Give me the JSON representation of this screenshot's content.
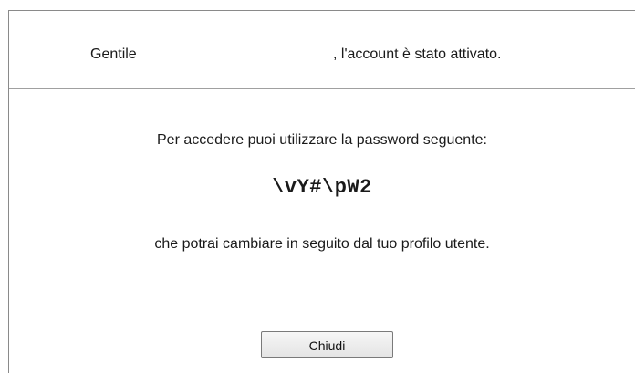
{
  "header": {
    "greeting": "Gentile",
    "activated_message": ", l'account è stato attivato."
  },
  "body": {
    "intro": "Per accedere puoi utilizzare la password seguente:",
    "password": "\\vY#\\pW2",
    "outro": "che potrai cambiare in seguito dal tuo profilo utente."
  },
  "footer": {
    "close_label": "Chiudi"
  }
}
